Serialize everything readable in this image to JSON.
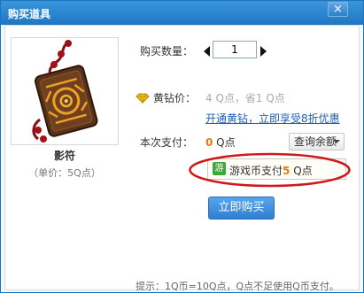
{
  "window": {
    "title": "购买道具",
    "close_label": "×"
  },
  "item": {
    "name": "影符",
    "unit_price": "（单价：5Q点）"
  },
  "purchase": {
    "quantity_label": "购买数量：",
    "quantity_value": "1",
    "gold_diamond_label": "黄钻价：",
    "gold_diamond_price": "4 Q点，省1 Q点",
    "upgrade_link": "开通黄钻，立即享受8折优惠",
    "payment_label": "本次支付：",
    "payment_value": "0",
    "payment_unit": " Q点",
    "balance_button": "查询余额",
    "pay_option_icon": "游",
    "pay_option_text": "游戏币支付",
    "pay_option_amount": "5",
    "pay_option_unit": " Q点",
    "buy_button": "立即购买"
  },
  "footer": {
    "note": "提示：1Q币=10Q点，Q点不足使用Q币支付。"
  },
  "colors": {
    "titlebar": "#2a86d3",
    "accent_orange": "#f07800",
    "link_blue": "#1f5fb0",
    "highlight_ring": "#d01818",
    "buy_button": "#3a8ad8"
  }
}
